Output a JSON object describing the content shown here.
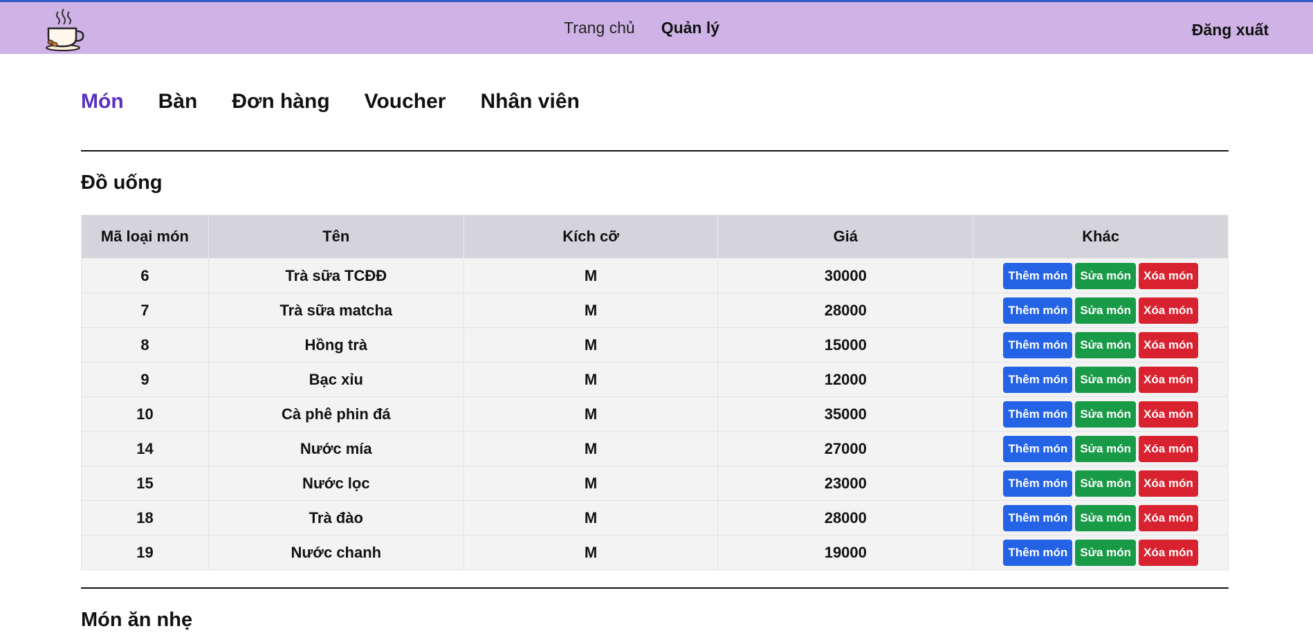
{
  "header": {
    "logo_icon": "coffee-cup-icon",
    "nav": {
      "home": "Trang chủ",
      "manage": "Quản lý"
    },
    "logout": "Đăng xuất",
    "colors": {
      "bar": "#cfb3e6",
      "border_top": "#2f58c4"
    }
  },
  "tabs": [
    {
      "label": "Món",
      "active": true
    },
    {
      "label": "Bàn",
      "active": false
    },
    {
      "label": "Đơn hàng",
      "active": false
    },
    {
      "label": "Voucher",
      "active": false
    },
    {
      "label": "Nhân viên",
      "active": false
    }
  ],
  "drinks": {
    "title": "Đồ uống",
    "columns": [
      "Mã loại món",
      "Tên",
      "Kích cỡ",
      "Giá",
      "Khác"
    ],
    "rows": [
      {
        "id": "6",
        "name": "Trà sữa TCĐĐ",
        "size": "M",
        "price": "30000"
      },
      {
        "id": "7",
        "name": "Trà sữa matcha",
        "size": "M",
        "price": "28000"
      },
      {
        "id": "8",
        "name": "Hồng trà",
        "size": "M",
        "price": "15000"
      },
      {
        "id": "9",
        "name": "Bạc xỉu",
        "size": "M",
        "price": "12000"
      },
      {
        "id": "10",
        "name": "Cà phê phin đá",
        "size": "M",
        "price": "35000"
      },
      {
        "id": "14",
        "name": "Nước mía",
        "size": "M",
        "price": "27000"
      },
      {
        "id": "15",
        "name": "Nước lọc",
        "size": "M",
        "price": "23000"
      },
      {
        "id": "18",
        "name": "Trà đào",
        "size": "M",
        "price": "28000"
      },
      {
        "id": "19",
        "name": "Nước chanh",
        "size": "M",
        "price": "19000"
      }
    ],
    "actions": {
      "add": "Thêm món",
      "edit": "Sửa món",
      "delete": "Xóa món"
    }
  },
  "snacks": {
    "title": "Món ăn nhẹ"
  },
  "colors": {
    "active_tab": "#5a2fc1",
    "add_button": "#2463e6",
    "edit_button": "#199a47",
    "delete_button": "#d9222f"
  }
}
